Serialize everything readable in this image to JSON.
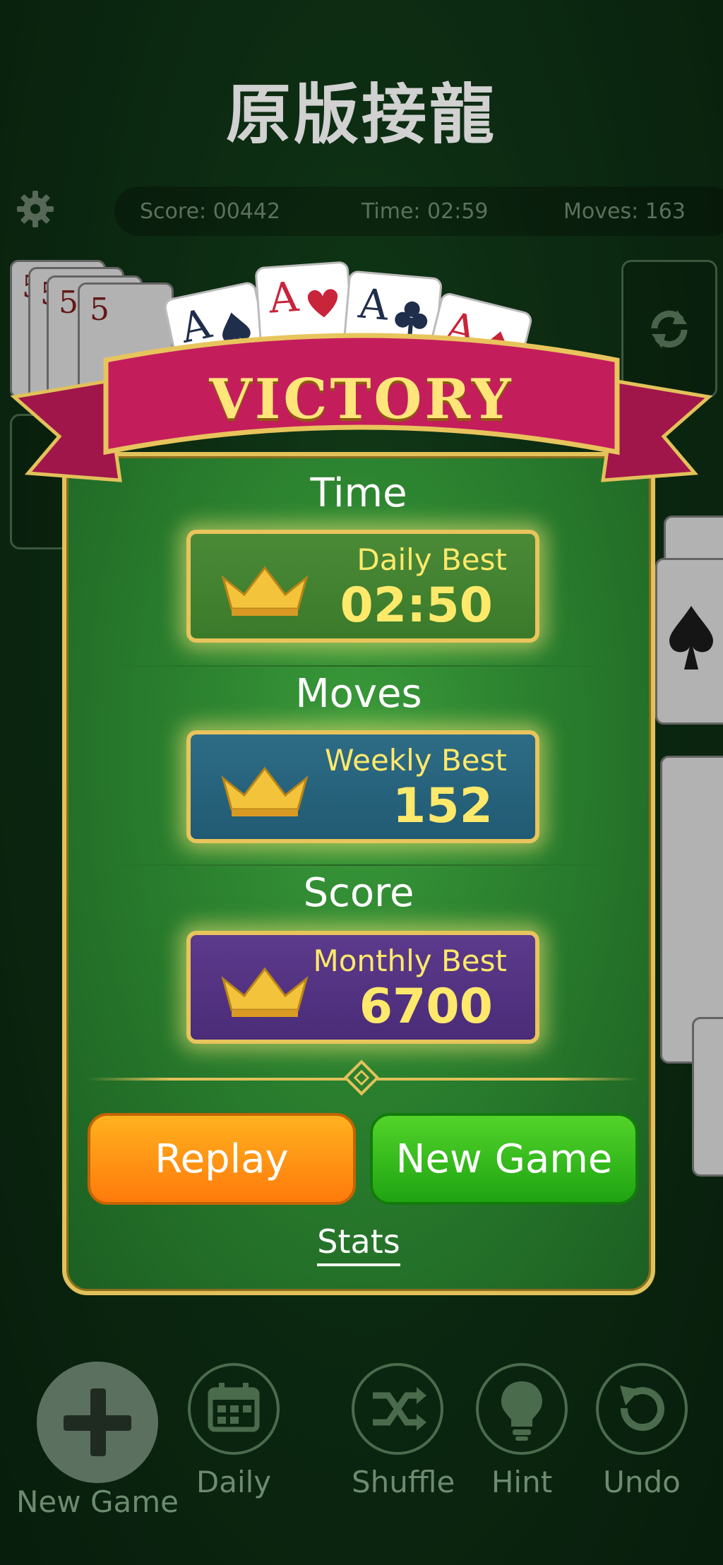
{
  "app": {
    "title": "原版接龍"
  },
  "stats_bar": {
    "score": "Score: 00442",
    "time": "Time: 02:59",
    "moves": "Moves: 163"
  },
  "victory": {
    "banner_text": "VICTORY",
    "sections": [
      {
        "label": "Time",
        "best_label": "Daily Best",
        "best_value": "02:50",
        "color": "#3b7a2a"
      },
      {
        "label": "Moves",
        "best_label": "Weekly Best",
        "best_value": "152",
        "color": "#215a73"
      },
      {
        "label": "Score",
        "best_label": "Monthly Best",
        "best_value": "6700",
        "color": "#4a2c78"
      }
    ],
    "buttons": {
      "replay": "Replay",
      "new_game": "New Game"
    },
    "stats_link": "Stats"
  },
  "toolbar": {
    "items": [
      {
        "label": "New Game",
        "icon": "plus-icon"
      },
      {
        "label": "Daily",
        "icon": "calendar-icon"
      },
      {
        "label": "Shuffle",
        "icon": "shuffle-icon"
      },
      {
        "label": "Hint",
        "icon": "lightbulb-icon"
      },
      {
        "label": "Undo",
        "icon": "undo-icon"
      }
    ]
  },
  "colors": {
    "gold": "#e2c15a",
    "text_gold": "#ffe96b",
    "replay": "#ff9a14",
    "new_game": "#2fbf1c",
    "ribbon": "#c21b5a"
  }
}
